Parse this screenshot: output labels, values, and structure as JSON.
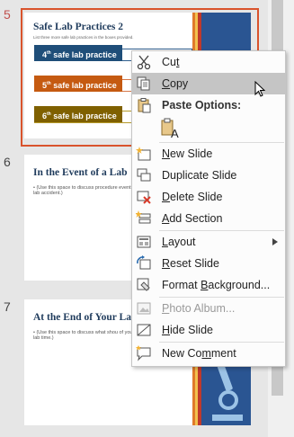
{
  "slides": [
    {
      "number": "5",
      "title": "Safe Lab Practices 2",
      "subtitle": "List three more safe lab practices in the boxes provided.",
      "bars": [
        "4th safe lab practice",
        "5th safe lab practice",
        "6th safe lab practice"
      ]
    },
    {
      "number": "6",
      "title": "In the Event of a Lab",
      "bullet": "• (Use this space to discuss procedure event of a lab accident.)"
    },
    {
      "number": "7",
      "title": "At the End of Your La",
      "bullet": "• (Use this space to discuss what shou of your lab time.)"
    }
  ],
  "colors": {
    "accent": "#c0504d",
    "navy": "#1f3b5c",
    "bar_blue": "#1f4e79",
    "bar_orange": "#c55a11",
    "bar_olive": "#7f6000",
    "deco": "#2a5592"
  },
  "context_menu": {
    "items": [
      {
        "name": "cut",
        "label": "Cut",
        "accel": "t",
        "icon": "scissors-icon"
      },
      {
        "name": "copy",
        "label": "Copy",
        "accel": "C",
        "icon": "copy-icon",
        "hover": true
      },
      {
        "name": "paste-options",
        "label": "Paste Options:",
        "icon": "clipboard-icon",
        "header": true
      },
      {
        "name": "paste-keep-text",
        "label": "",
        "icon": "paste-text-icon"
      },
      {
        "name": "new-slide",
        "label": "New Slide",
        "accel": "N",
        "icon": "new-slide-icon"
      },
      {
        "name": "duplicate-slide",
        "label": "Duplicate Slide",
        "accel": "A",
        "icon": "duplicate-slide-icon"
      },
      {
        "name": "delete-slide",
        "label": "Delete Slide",
        "accel": "D",
        "icon": "delete-slide-icon"
      },
      {
        "name": "add-section",
        "label": "Add Section",
        "accel": "A",
        "icon": "add-section-icon"
      },
      {
        "name": "layout",
        "label": "Layout",
        "accel": "L",
        "icon": "layout-icon",
        "submenu": true
      },
      {
        "name": "reset-slide",
        "label": "Reset Slide",
        "accel": "R",
        "icon": "reset-slide-icon"
      },
      {
        "name": "format-background",
        "label": "Format Background...",
        "accel": "B",
        "icon": "format-background-icon"
      },
      {
        "name": "photo-album",
        "label": "Photo Album...",
        "accel": "P",
        "icon": "photo-album-icon",
        "disabled": true
      },
      {
        "name": "hide-slide",
        "label": "Hide Slide",
        "accel": "H",
        "icon": "hide-slide-icon"
      },
      {
        "name": "new-comment",
        "label": "New Comment",
        "accel": "m",
        "icon": "new-comment-icon"
      }
    ]
  }
}
